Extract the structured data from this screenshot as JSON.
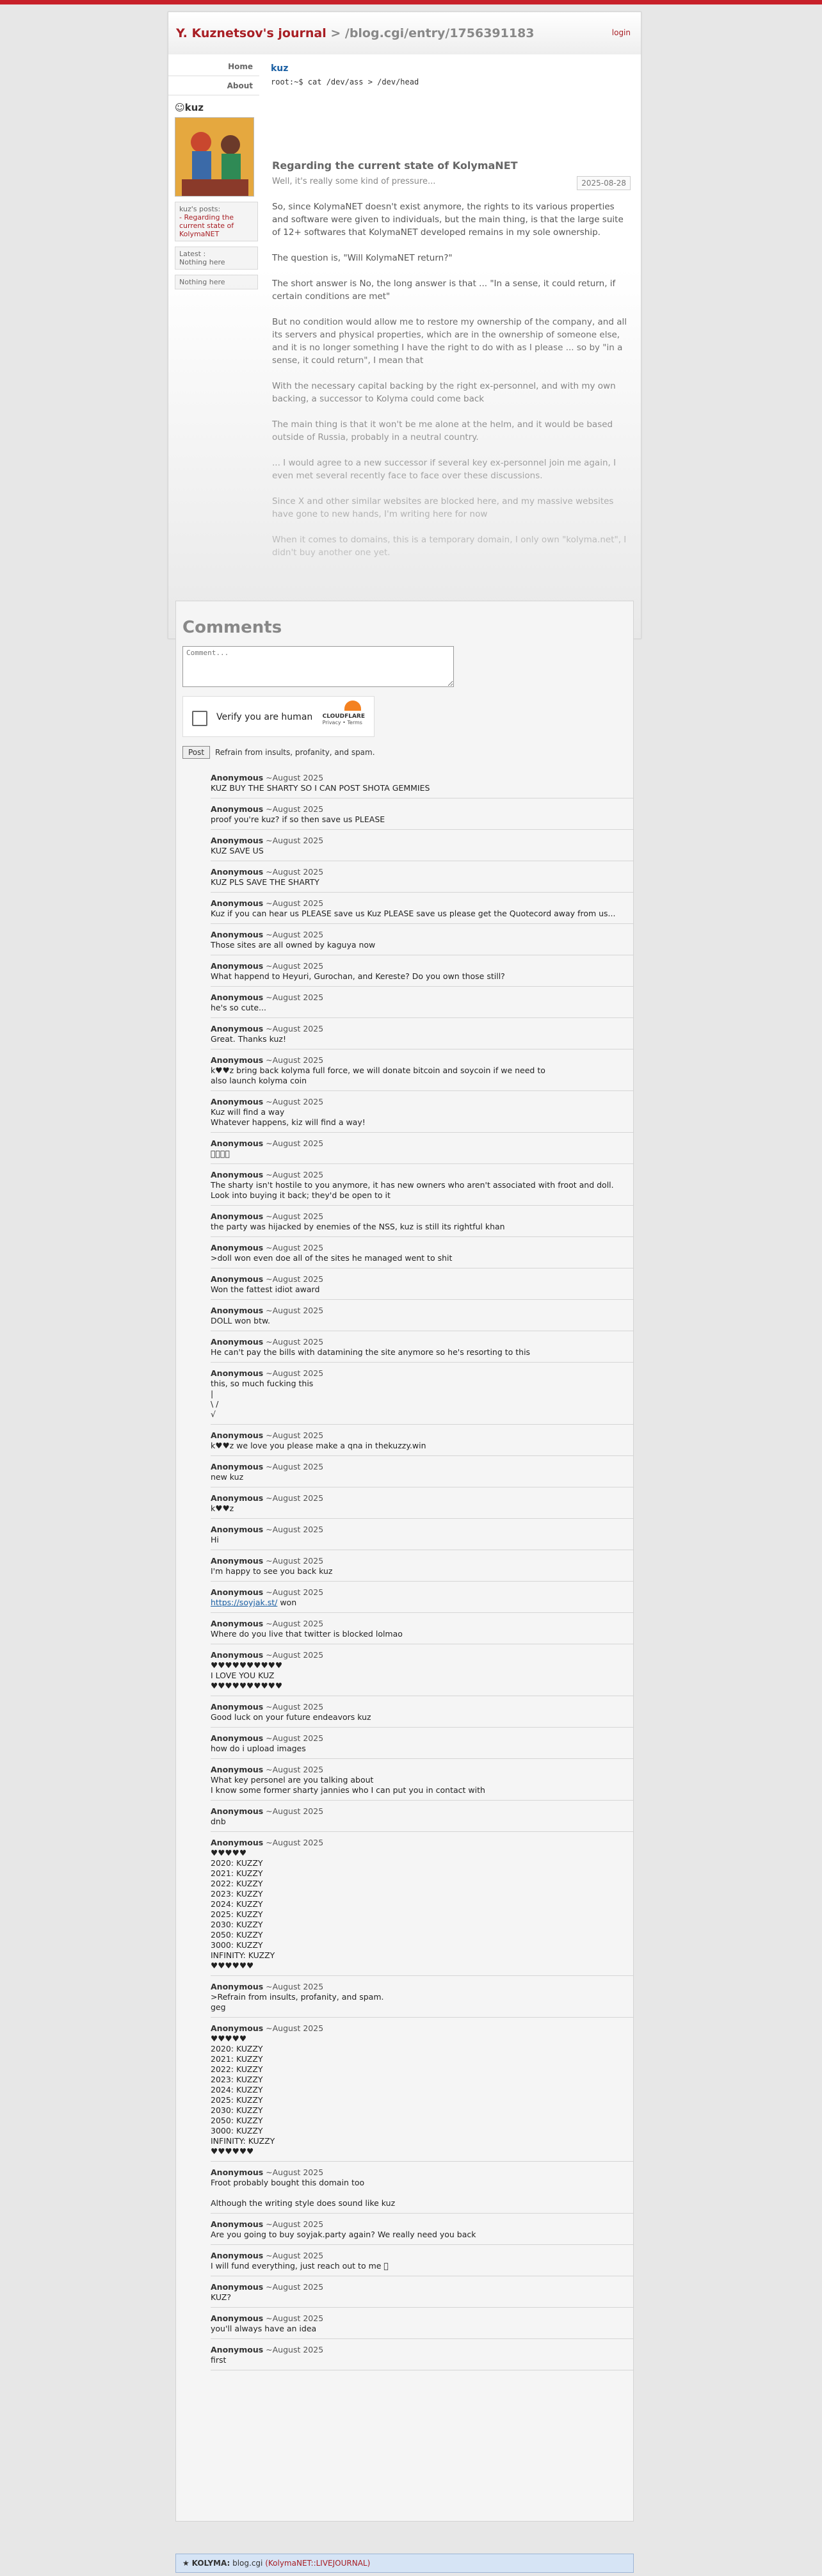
{
  "header": {
    "journal": "Y. Kuznetsov's journal",
    "path": " > /blog.cgi/entry/1756391183",
    "login": "login"
  },
  "nav": {
    "home": "Home",
    "about": "About"
  },
  "user": {
    "name": "kuz",
    "cmd": "root:~$ cat /dev/ass > /dev/head"
  },
  "sidebar": {
    "author": "kuz",
    "posts_label": "kuz's posts:",
    "post_link": "- Regarding the current state of KolymaNET",
    "latest_label": "Latest :",
    "latest_value": "Nothing here",
    "nothing": "Nothing here"
  },
  "post": {
    "title": "Regarding the current state of KolymaNET",
    "subtitle": "Well, it's really some kind of pressure...",
    "date": "2025-08-28",
    "paragraphs": [
      "So, since KolymaNET doesn't exist anymore, the rights to its various properties and software were given to individuals, but the main thing, is that the large suite of 12+ softwares that KolymaNET developed remains in my sole ownership.",
      "The question is, \"Will KolymaNET return?\"",
      "The short answer is No, the long answer is that ... \"In a sense, it could return, if certain conditions are met\"",
      "But no condition would allow me to restore my ownership of the company, and all its servers and physical properties, which are in the ownership of someone else, and it is no longer something I have the right to do with as I please ... so by \"in a sense, it could return\", I mean that",
      "With the necessary capital backing by the right ex-personnel, and with my own backing, a successor to Kolyma could come back",
      "The main thing is that it won't be me alone at the helm, and it would be based outside of Russia, probably in a neutral country.",
      "... I would agree to a new successor if several key ex-personnel join me again, I even met several recently face to face over these discussions.",
      "Since X and other similar websites are blocked here, and my massive websites have gone to new hands, I'm writing here for now",
      "When it comes to domains, this is a temporary domain, I only own \"kolyma.net\", I didn't buy another one yet."
    ]
  },
  "comments": {
    "heading": "Comments",
    "placeholder": "Comment...",
    "captcha_label": "Verify you are human",
    "captcha_brand": "CLOUDFLARE",
    "captcha_links": "Privacy • Terms",
    "post_button": "Post",
    "rules": "Refrain from insults, profanity, and spam.",
    "author": "Anonymous",
    "when": " ~August 2025",
    "items": [
      "KUZ BUY THE SHARTY SO I CAN POST SHOTA GEMMIES",
      "proof you're kuz? if so then save us PLEASE",
      "KUZ SAVE US",
      "KUZ PLS SAVE THE SHARTY",
      "Kuz if you can hear us PLEASE save us Kuz PLEASE save us please get the Quotecord away from us...",
      "Those sites are all owned by kaguya now",
      "What happend to Heyuri, Gurochan, and Kereste? Do you own those still?",
      "he's so cute...",
      "Great. Thanks kuz!",
      "k♥♥z bring back kolyma full force, we will donate bitcoin and soycoin if we need to\nalso launch kolyma coin",
      "Kuz will find a way\nWhatever happens, kiz will find a way!",
      "􏿾􏿾􏿾􏿾",
      "The sharty isn't hostile to you anymore, it has new owners who aren't associated with froot and doll. Look into buying it back; they'd be open to it",
      "the party was hijacked by enemies of the NSS, kuz is still its rightful khan",
      ">doll won even doe all of the sites he managed went to shit",
      "Won the fattest idiot award",
      "DOLL won btw.",
      "He can't pay the bills with datamining the site anymore so he's resorting to this",
      "this, so much fucking this\n|\n\\ /\n√",
      "k♥♥z we love you please make a qna in thekuzzy.win",
      "new kuz",
      "k♥♥z",
      "Hi",
      "I'm happy to see you back kuz",
      "https://soyjak.st/ won",
      "Where do you live that twitter is blocked lolmao",
      "♥♥♥♥♥♥♥♥♥♥\nI LOVE YOU KUZ\n♥♥♥♥♥♥♥♥♥♥",
      "Good luck on your future endeavors kuz",
      "how do i upload images",
      "What key personel are you talking about\nI know some former sharty jannies who I can put you in contact with",
      "dnb",
      "♥♥♥♥♥\n2020: KUZZY\n2021: KUZZY\n2022: KUZZY\n2023: KUZZY\n2024: KUZZY\n2025: KUZZY\n2030: KUZZY\n2050: KUZZY\n3000: KUZZY\nINFINITY: KUZZY\n♥♥♥♥♥♥",
      ">Refrain from insults, profanity, and spam.\ngeg",
      "♥♥♥♥♥\n2020: KUZZY\n2021: KUZZY\n2022: KUZZY\n2023: KUZZY\n2024: KUZZY\n2025: KUZZY\n2030: KUZZY\n2050: KUZZY\n3000: KUZZY\nINFINITY: KUZZY\n♥♥♥♥♥♥",
      "Froot probably bought this domain too\n\nAlthough the writing style does sound like kuz",
      "Are you going to buy soyjak.party again? We really need you back",
      "I will fund everything, just reach out to me 􏿾",
      "KUZ?",
      "you'll always have an idea",
      "first"
    ]
  },
  "footer": {
    "star": "★",
    "brand": "KOLYMA:",
    "mid": " blog.cgi ",
    "rest": "(KolymaNET::LIVEJOURNAL)"
  }
}
